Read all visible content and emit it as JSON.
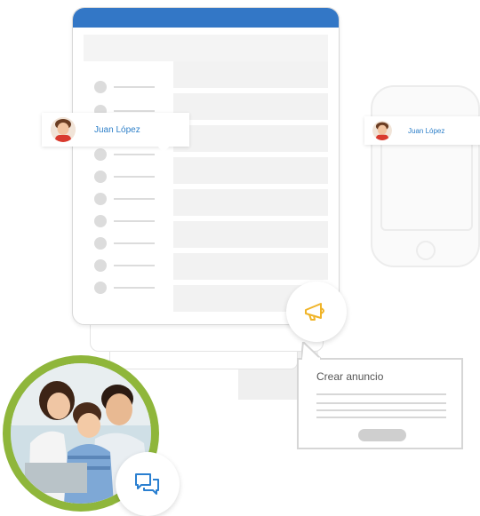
{
  "badges": [
    {
      "name": "Juan López"
    },
    {
      "name": "Juan López"
    }
  ],
  "popup": {
    "title": "Crear anuncio"
  },
  "icons": {
    "megaphone": "megaphone-icon",
    "chat": "chat-bubbles-icon"
  },
  "colors": {
    "header_blue": "#3377c6",
    "megaphone_yellow": "#f0b428",
    "chat_blue": "#2a7fd0",
    "ring_green": "#8fb63b",
    "name_blue": "#2f80c9"
  },
  "list": {
    "row_count": 8
  }
}
